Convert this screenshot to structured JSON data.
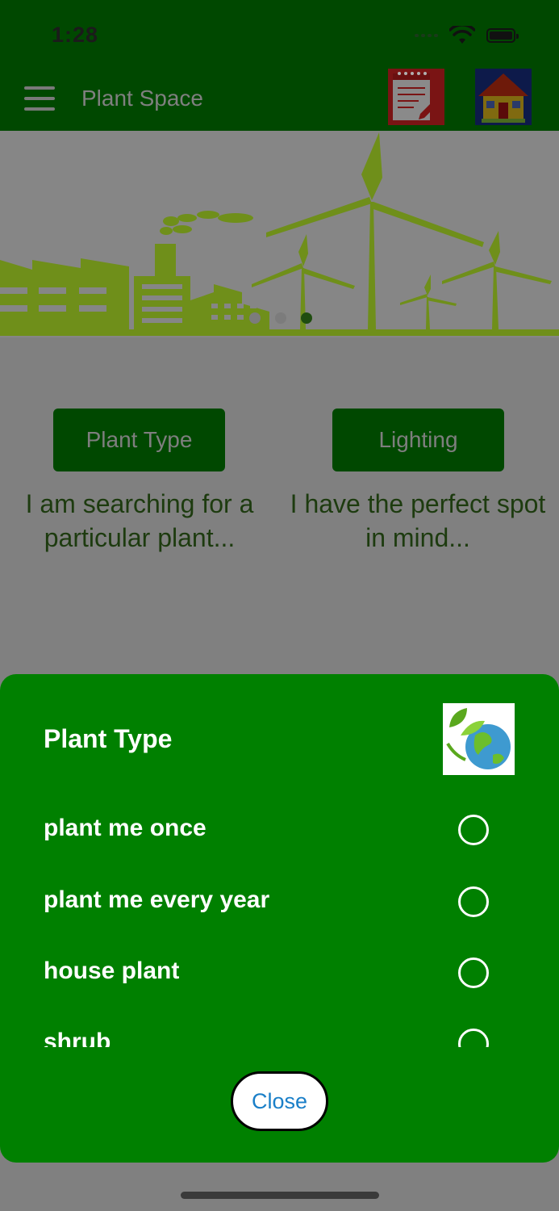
{
  "status_bar": {
    "time": "1:28"
  },
  "navbar": {
    "title": "Plant Space",
    "notes_icon": "notes-pencil-icon",
    "home_icon": "house-icon",
    "menu_icon": "hamburger-menu-icon"
  },
  "banner": {
    "carousel_pages": 3,
    "active_page": 3
  },
  "choices": [
    {
      "button": "Plant Type",
      "caption": "I am searching for a particular plant..."
    },
    {
      "button": "Lighting",
      "caption": "I have the perfect spot in mind..."
    }
  ],
  "sheet": {
    "title": "Plant Type",
    "logo_icon": "leaf-globe-icon",
    "options": [
      {
        "label": "plant me once",
        "selected": false
      },
      {
        "label": "plant me every year",
        "selected": false
      },
      {
        "label": "house plant",
        "selected": false
      },
      {
        "label": "shrub",
        "selected": false
      }
    ],
    "close_label": "Close"
  },
  "colors": {
    "nav_bg": "#004800",
    "sheet_bg": "#008000",
    "close_text": "#1a7fc8",
    "banner_green": "#6f8f1a"
  }
}
